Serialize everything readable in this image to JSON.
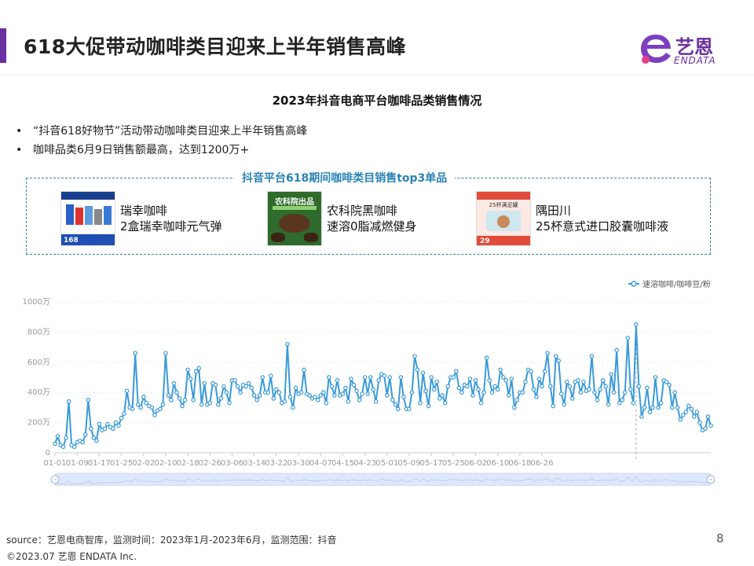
{
  "header": {
    "title": "618大促带动咖啡类目迎来上半年销售高峰",
    "logo_cn": "艺恩",
    "logo_en": "ENDATA",
    "accent_color": "#6a2fa0"
  },
  "section_title": "2023年抖音电商平台咖啡品类销售情况",
  "bullets": [
    "“抖音618好物节”活动带动咖啡类目迎来上半年销售高峰",
    "咖啡品类6月9日销售额最高，达到1200万+"
  ],
  "top3": {
    "title": "抖音平台618期间咖啡类目销售top3单品",
    "items": [
      {
        "brand": "瑞幸咖啡",
        "product": "2盒瑞幸咖啡元气弹",
        "image_price": "168"
      },
      {
        "brand": "农科院黑咖啡",
        "product": "速溶0脂减燃健身",
        "image_label": "农科院出品"
      },
      {
        "brand": "隅田川",
        "product": "25杯意式进口胶囊咖啡液",
        "image_label": "25杯满足罐",
        "image_price": "29"
      }
    ]
  },
  "chart_data": {
    "type": "line",
    "series": [
      {
        "name": "速溶咖啡/咖啡豆/粉",
        "color": "#3a9ad9"
      }
    ],
    "x_tick_labels": [
      "01-01",
      "01-09",
      "01-17",
      "01-25",
      "02-02",
      "02-10",
      "02-18",
      "02-26",
      "03-06",
      "03-14",
      "03-22",
      "03-30",
      "04-07",
      "04-15",
      "04-23",
      "05-01",
      "05-09",
      "05-17",
      "05-25",
      "06-02",
      "06-10",
      "06-18",
      "06-26"
    ],
    "y_tick_labels": [
      "0",
      "200万",
      "400万",
      "600万",
      "800万",
      "1000万"
    ],
    "ylim": [
      0,
      1000
    ],
    "y_unit": "万",
    "x_start": "01-01",
    "x_end": "06-30",
    "peak": {
      "x": "06-09",
      "y": 850
    },
    "values": [
      60,
      110,
      50,
      40,
      100,
      340,
      50,
      40,
      70,
      80,
      70,
      120,
      350,
      160,
      100,
      80,
      190,
      150,
      160,
      190,
      170,
      160,
      200,
      180,
      230,
      260,
      410,
      300,
      290,
      660,
      320,
      300,
      370,
      330,
      310,
      300,
      250,
      280,
      290,
      320,
      660,
      380,
      350,
      460,
      400,
      360,
      310,
      350,
      550,
      490,
      350,
      540,
      560,
      320,
      460,
      320,
      330,
      460,
      450,
      320,
      360,
      440,
      400,
      330,
      480,
      480,
      440,
      400,
      450,
      440,
      460,
      430,
      380,
      350,
      380,
      500,
      400,
      400,
      510,
      360,
      420,
      400,
      330,
      340,
      720,
      370,
      300,
      430,
      390,
      400,
      550,
      390,
      380,
      360,
      370,
      350,
      380,
      400,
      330,
      500,
      440,
      380,
      480,
      380,
      390,
      430,
      340,
      490,
      450,
      410,
      350,
      390,
      500,
      390,
      500,
      420,
      340,
      480,
      520,
      510,
      380,
      500,
      350,
      320,
      290,
      500,
      370,
      290,
      290,
      400,
      640,
      550,
      330,
      530,
      410,
      310,
      500,
      420,
      470,
      360,
      380,
      330,
      440,
      500,
      500,
      540,
      430,
      400,
      450,
      440,
      490,
      380,
      480,
      420,
      330,
      400,
      630,
      480,
      400,
      440,
      420,
      550,
      500,
      480,
      380,
      490,
      300,
      350,
      400,
      400,
      470,
      550,
      540,
      420,
      370,
      490,
      440,
      540,
      660,
      440,
      310,
      640,
      610,
      390,
      320,
      470,
      440,
      360,
      470,
      480,
      400,
      470,
      410,
      420,
      640,
      400,
      350,
      420,
      480,
      440,
      320,
      520,
      400,
      680,
      330,
      350,
      400,
      760,
      420,
      330,
      850,
      440,
      240,
      300,
      430,
      270,
      300,
      500,
      300,
      330,
      480,
      470,
      450,
      300,
      400,
      300,
      220,
      250,
      270,
      310,
      290,
      240,
      270,
      200,
      150,
      160,
      240,
      180
    ]
  },
  "footer": {
    "source": "source：艺恩电商智库，监测时间：2023年1月-2023年6月，监测范围：抖音",
    "copyright": "©2023.07 艺恩 ENDATA Inc.",
    "page_number": "8"
  }
}
